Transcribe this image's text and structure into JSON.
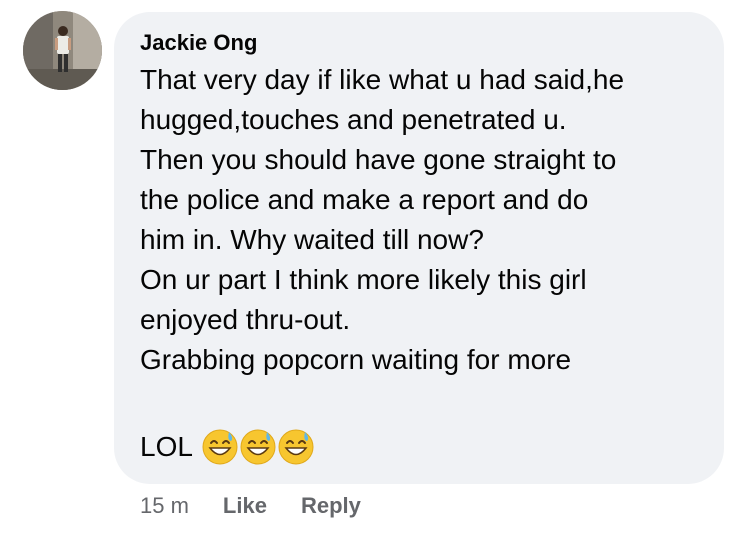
{
  "comment": {
    "author": "Jackie Ong",
    "lines": [
      "That very day if like what u had said,he",
      "hugged,touches and penetrated u.",
      "Then you should have gone straight to",
      "the police and make a report and do",
      "him in. Why waited till now?",
      "On ur part I think more likely this girl",
      "enjoyed thru-out.",
      "Grabbing popcorn waiting for more"
    ],
    "closing_text": "LOL",
    "emoji_icons": [
      "grinning-face-with-sweat-icon",
      "grinning-face-with-sweat-icon",
      "grinning-face-with-sweat-icon"
    ]
  },
  "actions": {
    "timestamp": "15 m",
    "like_label": "Like",
    "reply_label": "Reply"
  },
  "colors": {
    "bubble_background": "#f0f2f5",
    "text": "#050505",
    "secondary_text": "#65676b",
    "emoji_face": "#f7c62f"
  }
}
